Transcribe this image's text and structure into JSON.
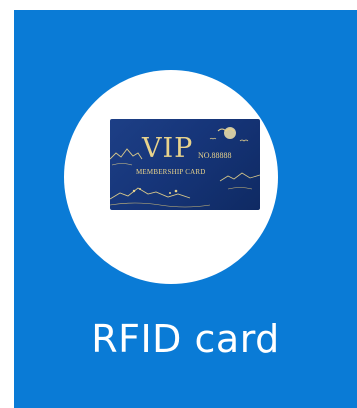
{
  "tile": {
    "label": "RFID card",
    "background_color": "#0a7bd6"
  },
  "card_image": {
    "title": "VIP",
    "number": "NO.88888",
    "subtitle": "MEMBERSHIP CARD",
    "card_color": "#163579",
    "text_color": "#e8d38c"
  }
}
